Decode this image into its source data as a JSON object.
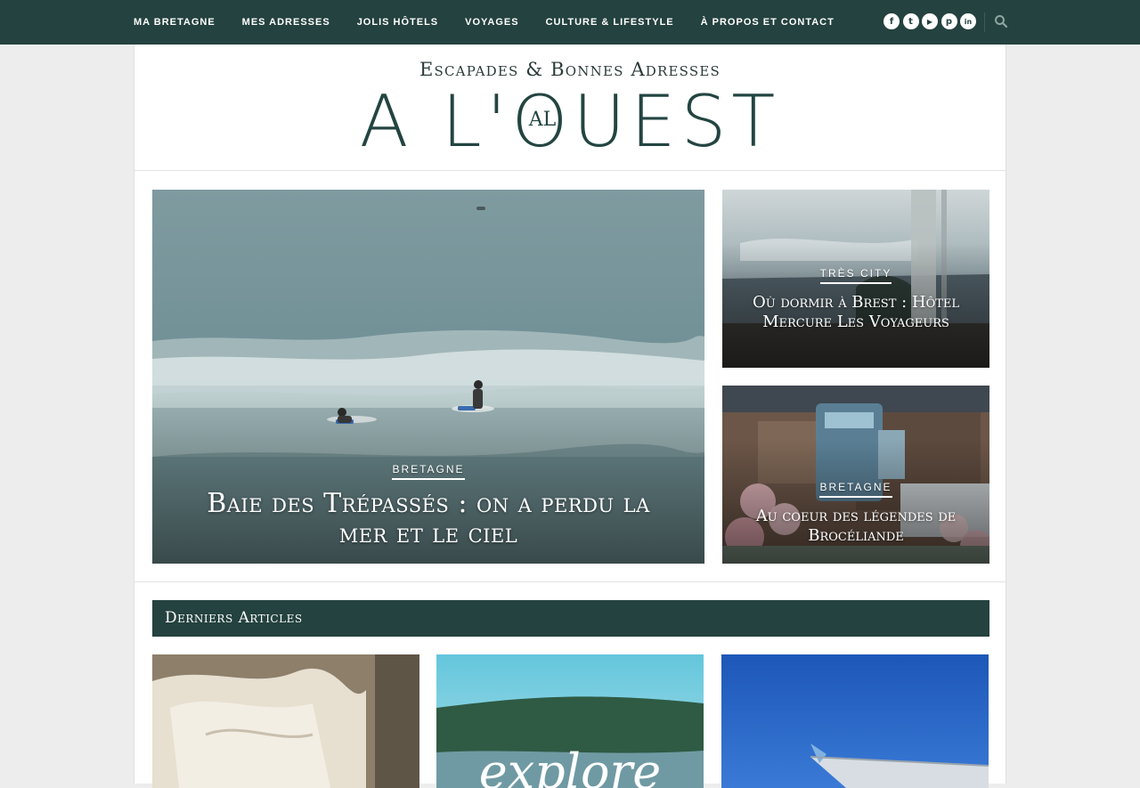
{
  "nav": {
    "items": [
      "MA BRETAGNE",
      "MES ADRESSES",
      "JOLIS HÔTELS",
      "VOYAGES",
      "CULTURE & LIFESTYLE",
      "À PROPOS ET CONTACT"
    ],
    "social_icons": [
      {
        "name": "facebook-icon",
        "glyph": "f"
      },
      {
        "name": "twitter-icon",
        "glyph": "t"
      },
      {
        "name": "youtube-icon",
        "glyph": "▶"
      },
      {
        "name": "pinterest-icon",
        "glyph": "p"
      },
      {
        "name": "linkedin-icon",
        "glyph": "in"
      }
    ],
    "search_icon": "search-icon"
  },
  "header": {
    "tagline": "Escapades & Bonnes Adresses",
    "logo_pre": "A L'",
    "logo_o": "O",
    "logo_mono": "AL",
    "logo_post": "UEST"
  },
  "featured": {
    "main": {
      "category": "BRETAGNE",
      "title": "Baie des Trépassés : on a perdu la mer et le ciel"
    },
    "side1": {
      "category": "TRÈS CITY",
      "title": "Où dormir à Brest : Hôtel Mercure Les Voyageurs"
    },
    "side2": {
      "category": "BRETAGNE",
      "title": "Au coeur des légendes de Brocéliande"
    }
  },
  "latest": {
    "heading": "Derniers Articles",
    "thumb3_text": "explore"
  },
  "colors": {
    "brand": "#24423f",
    "background": "#ededed",
    "card": "#ffffff"
  }
}
